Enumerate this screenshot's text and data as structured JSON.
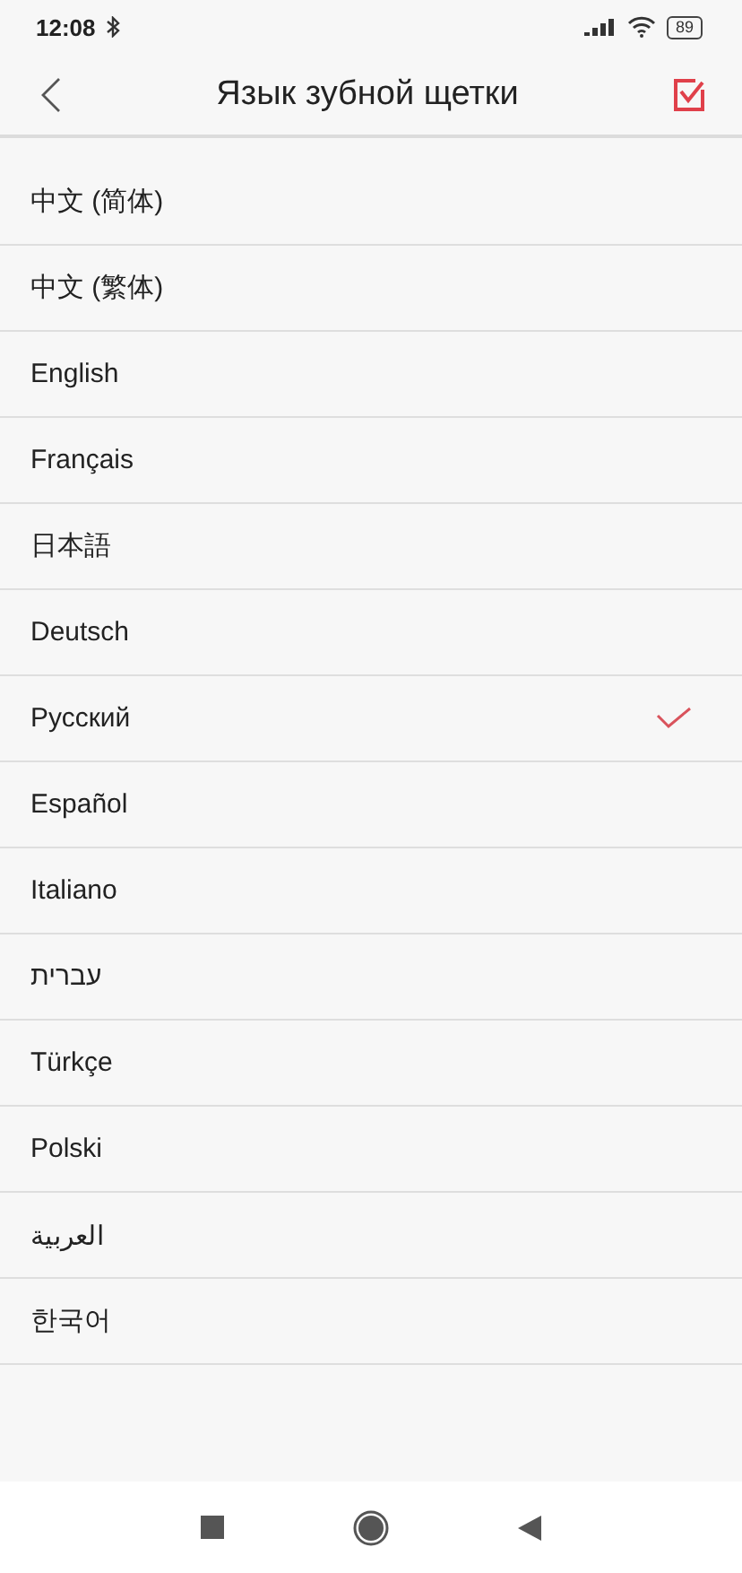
{
  "status_bar": {
    "time": "12:08",
    "battery": "89"
  },
  "header": {
    "title": "Язык зубной щетки"
  },
  "languages": [
    {
      "label": "中文 (简体)",
      "selected": false
    },
    {
      "label": "中文 (繁体)",
      "selected": false
    },
    {
      "label": "English",
      "selected": false
    },
    {
      "label": "Français",
      "selected": false
    },
    {
      "label": "日本語",
      "selected": false
    },
    {
      "label": "Deutsch",
      "selected": false
    },
    {
      "label": "Русский",
      "selected": true
    },
    {
      "label": "Español",
      "selected": false
    },
    {
      "label": "Italiano",
      "selected": false
    },
    {
      "label": "עברית",
      "selected": false
    },
    {
      "label": "Türkçe",
      "selected": false
    },
    {
      "label": "Polski",
      "selected": false
    },
    {
      "label": "العربية",
      "selected": false
    },
    {
      "label": "한국어",
      "selected": false
    }
  ]
}
